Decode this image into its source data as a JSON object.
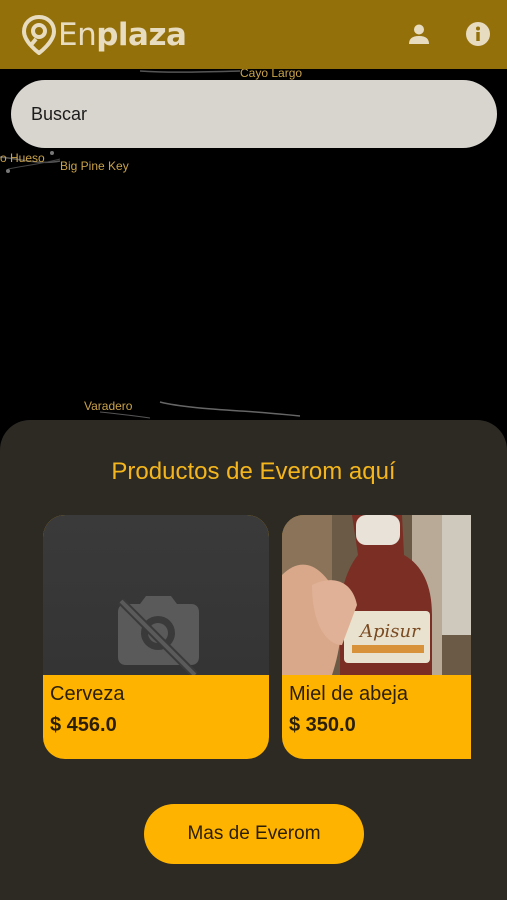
{
  "app": {
    "brand_prefix": "En",
    "brand_suffix": "plaza",
    "colors": {
      "appbar": "#94700a",
      "accent": "#ffb301",
      "sheet": "#2d2a24"
    },
    "icons": [
      "user-icon",
      "info-icon"
    ]
  },
  "search": {
    "placeholder": "Buscar"
  },
  "map": {
    "labels": [
      "Cayo Largo",
      "o Hueso",
      "Big Pine Key",
      "Varadero"
    ]
  },
  "sheet": {
    "title": "Productos de Everom aquí",
    "products": [
      {
        "name": "Cerveza",
        "price": "$ 456.0",
        "image": "no-image-camera-icon"
      },
      {
        "name": "Miel de abeja",
        "price": "$ 350.0",
        "image": "honey-bottle-photo"
      }
    ],
    "more_button": "Mas de Everom"
  }
}
